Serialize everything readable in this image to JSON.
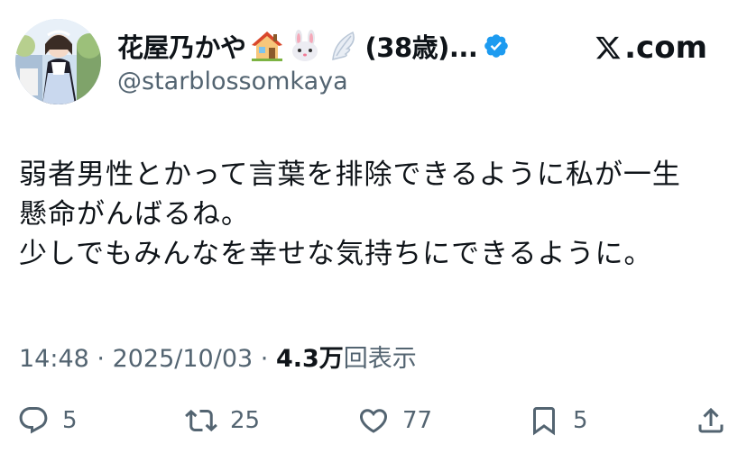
{
  "profile": {
    "display_name": "花屋乃かや",
    "emoji_icons": [
      "house-emoji",
      "rabbit-emoji",
      "wing-emoji"
    ],
    "age_suffix": "(38歳)...",
    "handle": "@starblossomkaya",
    "verified": true
  },
  "brand": {
    "label": ".com"
  },
  "tweet": {
    "lines": [
      "弱者男性とかって言葉を排除できるように私が一生",
      "懸命がんばるね。",
      "少しでもみんなを幸せな気持ちにできるように。"
    ]
  },
  "meta": {
    "time": "14:48",
    "separator": " · ",
    "date": "2025/10/03",
    "views_count": "4.3万",
    "views_label": "回表示"
  },
  "actions": {
    "replies": "5",
    "reposts": "25",
    "likes": "77",
    "bookmarks": "5"
  },
  "colors": {
    "text": "#0f1419",
    "secondary": "#536471",
    "verified_blue": "#1d9bf0"
  }
}
